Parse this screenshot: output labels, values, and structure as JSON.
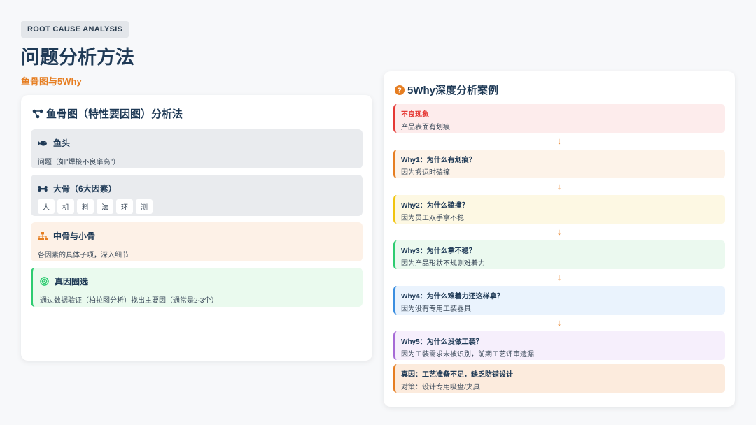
{
  "header": {
    "tag": "ROOT CAUSE ANALYSIS",
    "title": "问题分析方法",
    "subtitle": "鱼骨图与5Why"
  },
  "fishbone": {
    "title": "鱼骨图（特性要因图）分析法",
    "head": {
      "label": "鱼头",
      "text": "问题（如\"焊接不良率高\"）"
    },
    "bones": {
      "label": "大骨（6大因素）",
      "chips": [
        "人",
        "机",
        "料",
        "法",
        "环",
        "测"
      ]
    },
    "mid": {
      "label": "中骨与小骨",
      "text": "各因素的具体子项，深入细节"
    },
    "root": {
      "label": "真因圈选",
      "text": "通过数据验证（柏拉图分析）找出主要因（通常是2-3个）"
    }
  },
  "why": {
    "title": "5Why深度分析案例",
    "steps": [
      {
        "head": "不良现象",
        "text": "产品表面有划痕"
      },
      {
        "head": "Why1：为什么有划痕？",
        "text": "因为搬运时磕撞"
      },
      {
        "head": "Why2：为什么磕撞？",
        "text": "因为员工双手拿不稳"
      },
      {
        "head": "Why3：为什么拿不稳？",
        "text": "因为产品形状不规则难着力"
      },
      {
        "head": "Why4：为什么难着力还这样拿？",
        "text": "因为没有专用工装器具"
      },
      {
        "head": "Why5：为什么没做工装？",
        "text": "因为工装需求未被识别，前期工艺评审遗漏"
      },
      {
        "head": "真因：工艺准备不足，缺乏防错设计",
        "text": "对策：设计专用吸盘/夹具"
      }
    ],
    "arrow": "↓"
  },
  "colors": {
    "accent": "#e67e22",
    "title": "#1f3a56",
    "red": "#e53935",
    "green": "#2ecc71"
  }
}
